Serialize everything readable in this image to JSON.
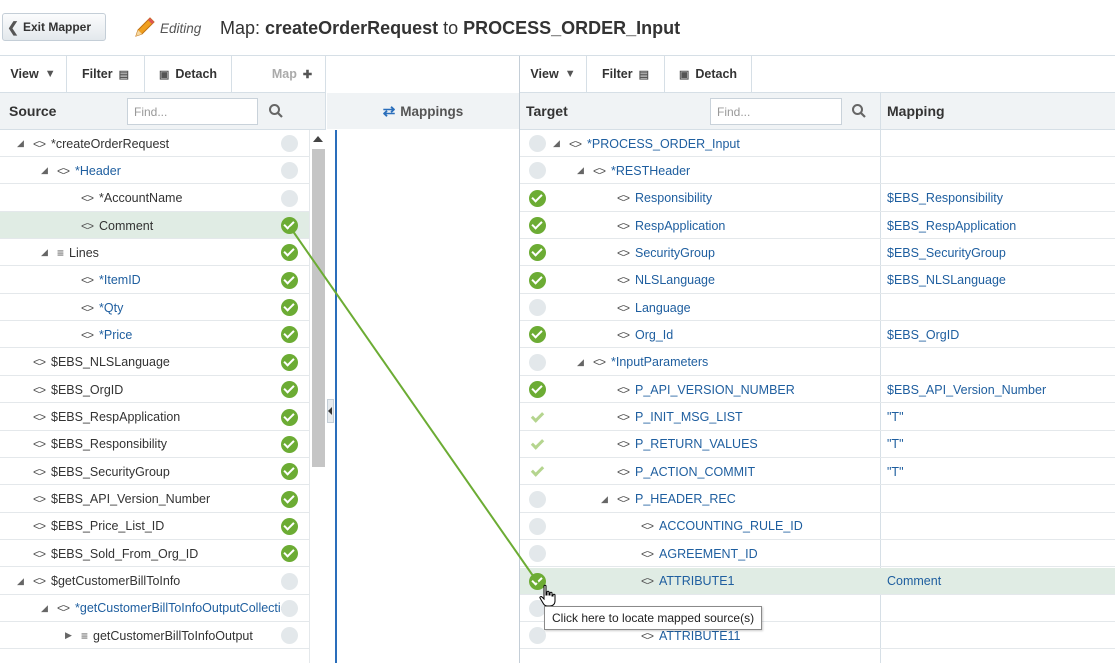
{
  "topbar": {
    "exit_label": "Exit Mapper",
    "editing_label": "Editing",
    "title_prefix": "Map:",
    "title_source": "createOrderRequest",
    "title_to": "to",
    "title_target": "PROCESS_ORDER_Input"
  },
  "left": {
    "toolbar": {
      "view": "View",
      "filter": "Filter",
      "detach": "Detach",
      "map": "Map"
    },
    "header": "Source",
    "find_placeholder": "Find...",
    "rows": [
      {
        "label": "*createOrderRequest",
        "color": "dark",
        "status": "none"
      },
      {
        "label": "*Header",
        "color": "blue",
        "status": "none"
      },
      {
        "label": "*AccountName",
        "color": "dark",
        "status": "none"
      },
      {
        "label": "Comment",
        "color": "dark",
        "status": "ok"
      },
      {
        "label": "Lines",
        "color": "dark",
        "status": "ok"
      },
      {
        "label": "*ItemID",
        "color": "blue",
        "status": "ok"
      },
      {
        "label": "*Qty",
        "color": "blue",
        "status": "ok"
      },
      {
        "label": "*Price",
        "color": "blue",
        "status": "ok"
      },
      {
        "label": "$EBS_NLSLanguage",
        "color": "dark",
        "status": "ok"
      },
      {
        "label": "$EBS_OrgID",
        "color": "dark",
        "status": "ok"
      },
      {
        "label": "$EBS_RespApplication",
        "color": "dark",
        "status": "ok"
      },
      {
        "label": "$EBS_Responsibility",
        "color": "dark",
        "status": "ok"
      },
      {
        "label": "$EBS_SecurityGroup",
        "color": "dark",
        "status": "ok"
      },
      {
        "label": "$EBS_API_Version_Number",
        "color": "dark",
        "status": "ok"
      },
      {
        "label": "$EBS_Price_List_ID",
        "color": "dark",
        "status": "ok"
      },
      {
        "label": "$EBS_Sold_From_Org_ID",
        "color": "dark",
        "status": "ok"
      },
      {
        "label": "$getCustomerBillToInfo",
        "color": "dark",
        "status": "none"
      },
      {
        "label": "*getCustomerBillToInfoOutputCollection",
        "color": "blue",
        "status": "none"
      },
      {
        "label": "getCustomerBillToInfoOutput",
        "color": "dark",
        "status": "none"
      }
    ]
  },
  "middle": {
    "header": "Mappings"
  },
  "right": {
    "toolbar": {
      "view": "View",
      "filter": "Filter",
      "detach": "Detach"
    },
    "header": "Target",
    "mapping_header": "Mapping",
    "find_placeholder": "Find...",
    "rows": [
      {
        "label": "*PROCESS_ORDER_Input",
        "status": "none",
        "mapping": ""
      },
      {
        "label": "*RESTHeader",
        "status": "none",
        "mapping": ""
      },
      {
        "label": "Responsibility",
        "status": "ok",
        "mapping": "$EBS_Responsibility"
      },
      {
        "label": "RespApplication",
        "status": "ok",
        "mapping": "$EBS_RespApplication"
      },
      {
        "label": "SecurityGroup",
        "status": "ok",
        "mapping": "$EBS_SecurityGroup"
      },
      {
        "label": "NLSLanguage",
        "status": "ok",
        "mapping": "$EBS_NLSLanguage"
      },
      {
        "label": "Language",
        "status": "none",
        "mapping": ""
      },
      {
        "label": "Org_Id",
        "status": "ok",
        "mapping": "$EBS_OrgID"
      },
      {
        "label": "*InputParameters",
        "status": "none",
        "mapping": ""
      },
      {
        "label": "P_API_VERSION_NUMBER",
        "status": "ok",
        "mapping": "$EBS_API_Version_Number"
      },
      {
        "label": "P_INIT_MSG_LIST",
        "status": "light",
        "mapping": "\"T\""
      },
      {
        "label": "P_RETURN_VALUES",
        "status": "light",
        "mapping": "\"T\""
      },
      {
        "label": "P_ACTION_COMMIT",
        "status": "light",
        "mapping": "\"T\""
      },
      {
        "label": "P_HEADER_REC",
        "status": "none",
        "mapping": ""
      },
      {
        "label": "ACCOUNTING_RULE_ID",
        "status": "none",
        "mapping": ""
      },
      {
        "label": "AGREEMENT_ID",
        "status": "none",
        "mapping": ""
      },
      {
        "label": "ATTRIBUTE1",
        "status": "ok",
        "mapping": "Comment"
      },
      {
        "label": "",
        "status": "none",
        "mapping": ""
      },
      {
        "label": "ATTRIBUTE11",
        "status": "none",
        "mapping": ""
      }
    ]
  },
  "tooltip": "Click here to locate mapped source(s)",
  "colors": {
    "accent": "#1e5e9f",
    "ok": "#6cac34",
    "link": "#6cac34",
    "selected": "#e0ece4"
  }
}
